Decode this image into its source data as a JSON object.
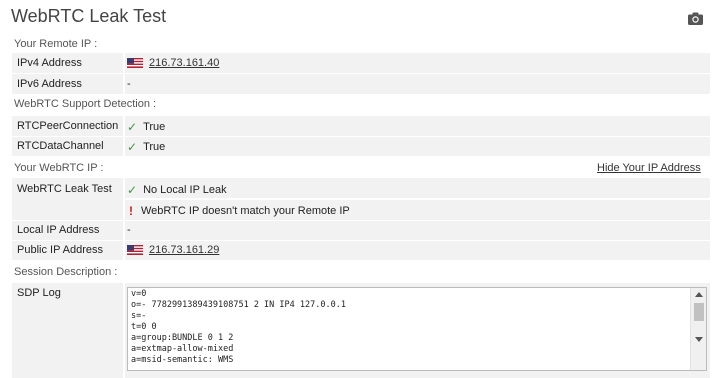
{
  "page": {
    "title": "WebRTC Leak Test"
  },
  "remote_ip": {
    "section": "Your Remote IP :",
    "ipv4_label": "IPv4 Address",
    "ipv4_value": "216.73.161.40",
    "ipv6_label": "IPv6 Address",
    "ipv6_value": "-"
  },
  "support": {
    "section": "WebRTC Support Detection :",
    "peer_label": "RTCPeerConnection",
    "peer_value": "True",
    "channel_label": "RTCDataChannel",
    "channel_value": "True"
  },
  "webrtc_ip": {
    "section": "Your WebRTC IP :",
    "hide_link": "Hide Your IP Address",
    "leak_label": "WebRTC Leak Test",
    "leak_value": "No Local IP Leak",
    "mismatch_value": "WebRTC IP doesn't match your Remote IP",
    "local_label": "Local IP Address",
    "local_value": "-",
    "public_label": "Public IP Address",
    "public_value": "216.73.161.29"
  },
  "session": {
    "section": "Session Description :",
    "sdp_label": "SDP Log",
    "sdp_text": "v=0\no=- 7782991389439108751 2 IN IP4 127.0.0.1\ns=-\nt=0 0\na=group:BUNDLE 0 1 2\na=extmap-allow-mixed\na=msid-semantic: WMS"
  },
  "colors": {
    "check": "#3a9a3a",
    "warning": "#c8211e",
    "row_bg": "#f2f2f2"
  },
  "icons": {
    "camera": "camera-icon",
    "flag": "us-flag-icon",
    "check": "check-icon",
    "warning": "exclamation-icon"
  }
}
